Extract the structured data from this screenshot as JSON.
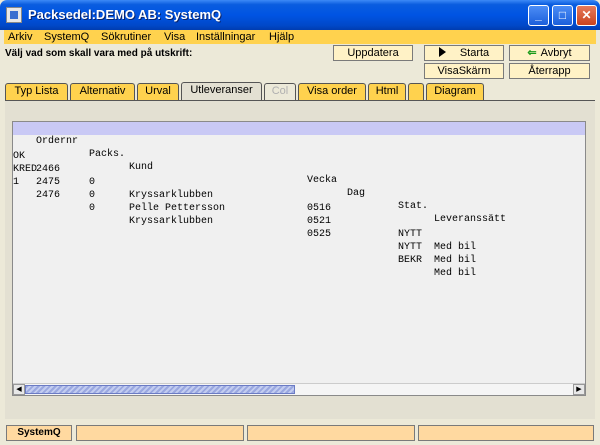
{
  "window": {
    "title": "Packsedel:DEMO AB: SystemQ"
  },
  "menu": [
    "Arkiv",
    "SystemQ",
    "Sökrutiner",
    "Visa",
    "Inställningar",
    "Hjälp"
  ],
  "instruction": "Välj vad som skall vara med på utskrift:",
  "buttons": {
    "update": "Uppdatera",
    "start": "Starta",
    "cancel": "Avbryt",
    "view_screen": "VisaSkärm",
    "reset": "Återrapp"
  },
  "tabs": [
    "Typ Lista",
    "Alternativ",
    "Urval",
    "Utleveranser",
    "Col",
    "Visa order",
    "Html",
    "",
    "Diagram"
  ],
  "active_tab": "Utleveranser",
  "table": {
    "columns": [
      "Ordernr",
      "Packs.",
      "Kund",
      "Vecka",
      "Dag",
      "Stat.",
      "Leveranssätt"
    ],
    "rows": [
      [
        "OK",
        "2466",
        "0",
        "Kryssarklubben",
        "0516",
        "",
        "NYTT",
        "Med bil"
      ],
      [
        "KRED",
        "2475",
        "0",
        "Pelle Pettersson",
        "0521",
        "",
        "NYTT",
        "Med bil"
      ],
      [
        "1",
        "2476",
        "0",
        "Kryssarklubben",
        "0525",
        "",
        "BEKR",
        "Med bil"
      ]
    ]
  },
  "status": [
    "SystemQ",
    "",
    "",
    "",
    ""
  ],
  "colors": {
    "titlebar": "#0054e3",
    "menubar": "#ffd24e",
    "button": "#fff2c6",
    "header_row": "#c9c9f5",
    "status": "#ffd9a0"
  }
}
